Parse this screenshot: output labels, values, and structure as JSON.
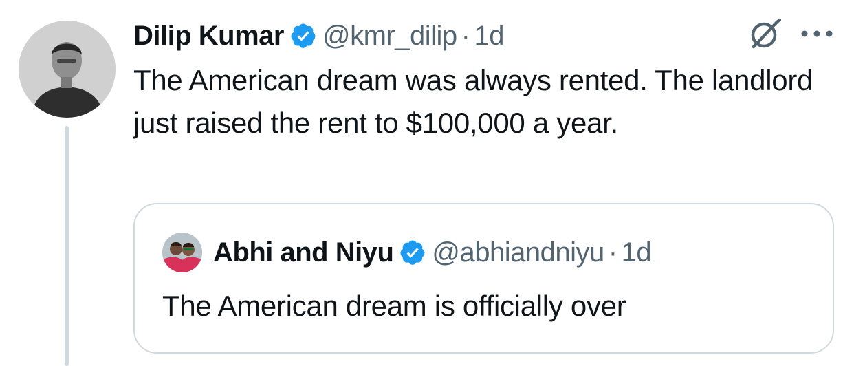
{
  "tweet": {
    "author_name": "Dilip Kumar",
    "author_handle": "@kmr_dilip",
    "separator": "·",
    "time": "1d",
    "text": "The American dream was always rented. The landlord just raised the rent to $100,000 a year."
  },
  "quoted_tweet": {
    "author_name": "Abhi and Niyu",
    "author_handle": "@abhiandniyu",
    "separator": "·",
    "time": "1d",
    "text": "The American dream is officially over"
  },
  "icons": {
    "verified": "verified-badge-icon",
    "grok": "grok-icon",
    "more": "more-options-icon"
  },
  "colors": {
    "verified_blue": "#1d9bf0",
    "secondary_text": "#536471",
    "border": "#cfd9de"
  }
}
